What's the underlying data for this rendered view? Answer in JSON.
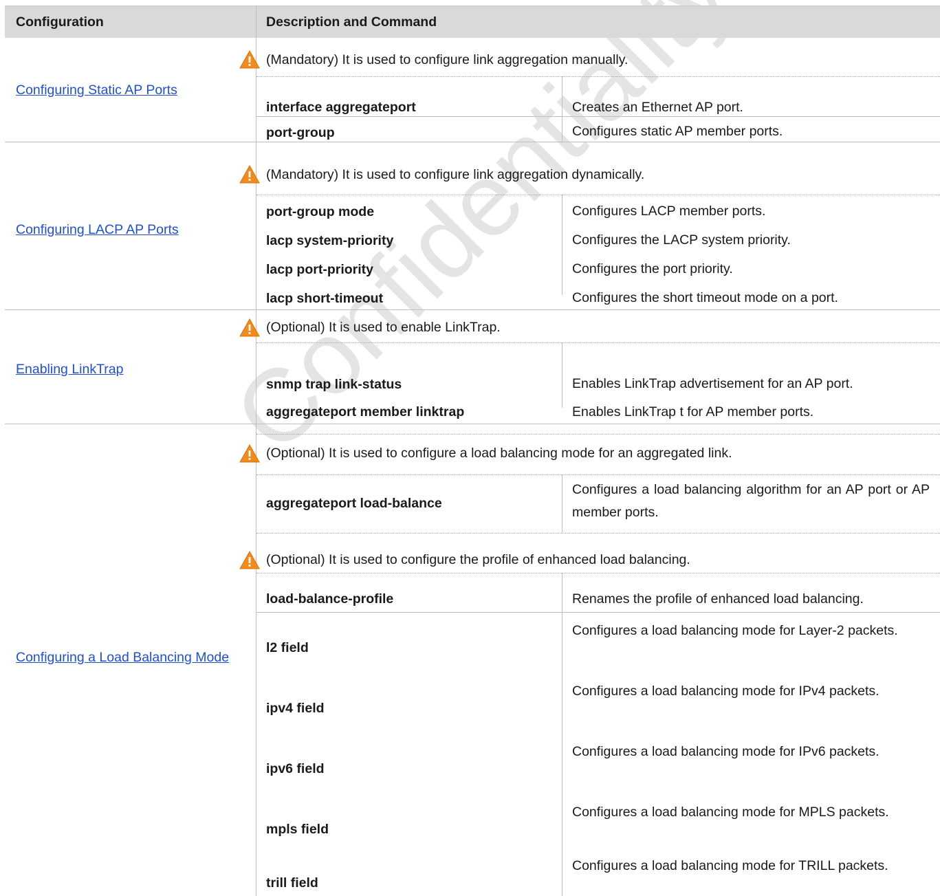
{
  "header": {
    "col1": "Configuration",
    "col2": "Description and Command"
  },
  "watermark": "Confidentiality: Controlled",
  "sections": {
    "static": {
      "link": "Configuring Static AP Ports",
      "note": "(Mandatory) It is used to configure link aggregation manually.",
      "rows": [
        {
          "cmd": "interface aggregateport",
          "desc": "Creates an Ethernet AP port."
        },
        {
          "cmd": "port-group",
          "desc": "Configures static AP member ports."
        }
      ]
    },
    "lacp": {
      "link": "Configuring LACP AP Ports",
      "note": "(Mandatory) It is used to configure link aggregation dynamically.",
      "rows": [
        {
          "cmd": "port-group mode",
          "desc": "Configures LACP member ports."
        },
        {
          "cmd": "lacp system-priority",
          "desc": "Configures the LACP system priority."
        },
        {
          "cmd": "lacp port-priority",
          "desc": "Configures the port priority."
        },
        {
          "cmd": "lacp short-timeout",
          "desc": "Configures the short timeout mode on a port."
        }
      ]
    },
    "linktrap": {
      "link": "Enabling LinkTrap",
      "note": "(Optional) It is used to enable LinkTrap.",
      "rows": [
        {
          "cmd": "snmp trap link-status",
          "desc": "Enables LinkTrap advertisement for an AP port."
        },
        {
          "cmd": "aggregateport member linktrap",
          "desc": "Enables LinkTrap t for AP member ports."
        }
      ]
    },
    "loadbalance": {
      "link": "Configuring a Load Balancing Mode",
      "note1": "(Optional) It is used to configure a load balancing mode for an aggregated link.",
      "row_lb": {
        "cmd": "aggregateport load-balance",
        "desc": "Configures a load balancing algorithm for an AP port or AP member ports."
      },
      "note2": "(Optional) It is used to configure the profile of enhanced load balancing.",
      "rows": [
        {
          "cmd": "load-balance-profile",
          "desc": "Renames the profile of enhanced load balancing."
        },
        {
          "cmd": "l2 field",
          "desc": "Configures a load balancing mode for Layer-2 packets."
        },
        {
          "cmd": "ipv4 field",
          "desc": "Configures a load balancing mode for IPv4 packets."
        },
        {
          "cmd": "ipv6 field",
          "desc": "Configures a load balancing mode for IPv6 packets."
        },
        {
          "cmd": "mpls field",
          "desc": "Configures a load balancing mode for MPLS packets."
        },
        {
          "cmd": "trill field",
          "desc": "Configures a load balancing mode for TRILL packets."
        }
      ]
    }
  },
  "icons": {
    "warning": "warning-triangle-icon",
    "warning_color": "#f08c1e"
  }
}
